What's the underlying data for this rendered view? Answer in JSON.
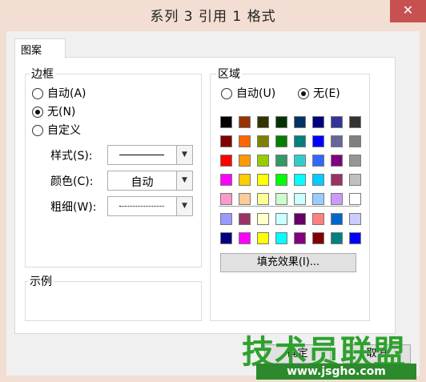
{
  "window": {
    "title": "系列 3 引用 1 格式",
    "close": "✕"
  },
  "tabs": [
    {
      "label": "图案"
    }
  ],
  "border_group": {
    "legend": "边框",
    "options": [
      {
        "label": "自动(A)",
        "selected": false
      },
      {
        "label": "无(N)",
        "selected": true
      },
      {
        "label": "自定义",
        "selected": false
      }
    ],
    "style_label": "样式(S):",
    "color_label": "颜色(C):",
    "color_value": "自动",
    "weight_label": "粗细(W):"
  },
  "area_group": {
    "legend": "区域",
    "options": [
      {
        "label": "自动(U)",
        "selected": false
      },
      {
        "label": "无(E)",
        "selected": true
      }
    ],
    "palette_main": [
      [
        "#000000",
        "#993300",
        "#333300",
        "#003300",
        "#003366",
        "#000080",
        "#333399",
        "#333333"
      ],
      [
        "#800000",
        "#FF6600",
        "#808000",
        "#008000",
        "#008080",
        "#0000FF",
        "#666699",
        "#808080"
      ],
      [
        "#FF0000",
        "#FF9900",
        "#99CC00",
        "#339966",
        "#33CCCC",
        "#3366FF",
        "#800080",
        "#969696"
      ],
      [
        "#FF00FF",
        "#FFCC00",
        "#FFFF00",
        "#00FF00",
        "#00FFFF",
        "#00CCFF",
        "#993366",
        "#C0C0C0"
      ],
      [
        "#FF99CC",
        "#FFCC99",
        "#FFFF99",
        "#CCFFCC",
        "#CCFFFF",
        "#99CCFF",
        "#CC99FF",
        "#FFFFFF"
      ]
    ],
    "palette_chart": [
      [
        "#9999FF",
        "#993366",
        "#FFFFCC",
        "#CCFFFF",
        "#660066",
        "#FF8080",
        "#0066CC",
        "#CCCCFF"
      ],
      [
        "#000080",
        "#FF00FF",
        "#FFFF00",
        "#00FFFF",
        "#800080",
        "#800000",
        "#008080",
        "#0000FF"
      ]
    ],
    "fill_effects_button": "填充效果(I)..."
  },
  "sample_group": {
    "legend": "示例"
  },
  "footer": {
    "ok_button": "确定",
    "cancel_button": "取消"
  },
  "watermark": {
    "text": "技术员联盟",
    "url": "www.jsgho.com"
  }
}
